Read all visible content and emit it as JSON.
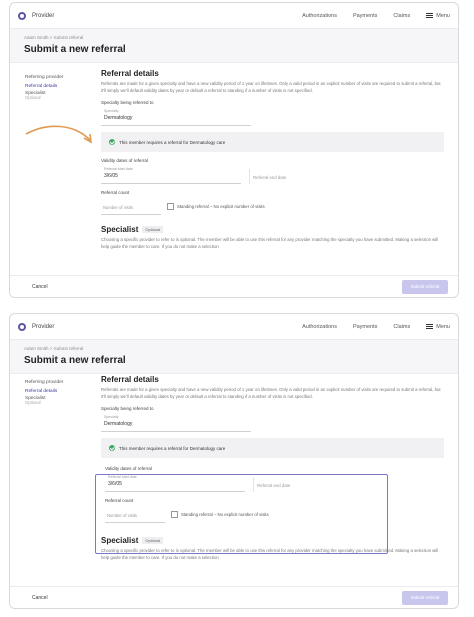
{
  "app": {
    "brand": "Provider",
    "nav": [
      "Authorizations",
      "Payments",
      "Claims"
    ],
    "menu_label": "Menu"
  },
  "header": {
    "breadcrumb_start": "Adam Smith",
    "breadcrumb_sep": ">",
    "breadcrumb_end": "Submit referral",
    "title": "Submit a new referral"
  },
  "sidebar": {
    "items": [
      {
        "label": "Referring provider"
      },
      {
        "label": "Referral details"
      },
      {
        "label": "Specialist"
      }
    ],
    "optional_label": "Optional"
  },
  "referral": {
    "section_title": "Referral details",
    "intro": "Referrals are made for a given specialty and have a new validity period of 1 year on lifetimes. Only a valid period in an explicit number of visits are required to submit a referral, but it'll simply we'll default validity dates by year or default a referral to standing if a number of visits is not specified.",
    "specialty_label": "Specialty being referred to",
    "specialty_small": "Specialty",
    "specialty_value": "Dermatology",
    "banner": "This member requires a referral for Dermatology care",
    "validity_label": "Validity dates of referral",
    "start_small": "Referral start date",
    "start_value": "3/6/05",
    "end_placeholder": "Referral end date",
    "count_label": "Referral count",
    "count_placeholder": "Number of visits",
    "standing_label": "Standing referral – No explicit number of visits"
  },
  "specialist": {
    "title": "Specialist",
    "badge": "Optional",
    "description": "Choosing a specific provider to refer to is optional. The member will be able to use this referral for any provider matching the specialty you have submitted. Making a selection will help guide the member to care. If you do not make a selection"
  },
  "footer": {
    "cancel": "Cancel",
    "submit": "Submit referral"
  },
  "colors": {
    "brand": "#5b57a6",
    "highlight": "#7b78c9",
    "arrow": "#e09a52",
    "submit_bg": "#c9c6ee",
    "check": "#3ea864"
  }
}
